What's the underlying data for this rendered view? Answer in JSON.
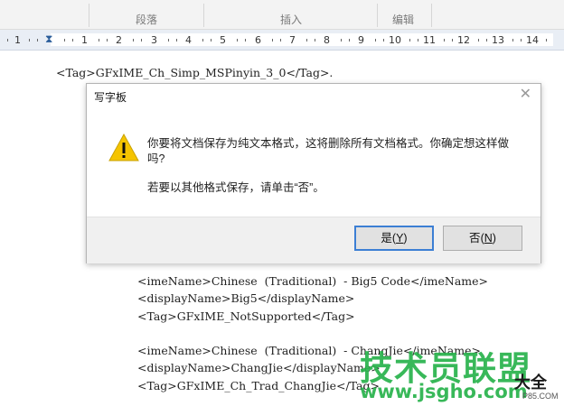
{
  "ribbon": {
    "groups": [
      "段落",
      "插入",
      "编辑"
    ]
  },
  "ruler": {
    "numbers": [
      "1",
      "1",
      "2",
      "3",
      "4",
      "5",
      "6",
      "7",
      "8",
      "9",
      "10",
      "11",
      "12",
      "13",
      "14"
    ]
  },
  "document": {
    "line_top": "<Tag>GFxIME_Ch_Simp_MSPinyin_3_0</Tag>.",
    "lines": [
      "<imeName>Chinese  (Traditional)  - Big5 Code</imeName>",
      "<displayName>Big5</displayName>",
      "<Tag>GFxIME_NotSupported</Tag>",
      "<imeName>Chinese  (Traditional)  - ChangJie</imeName>",
      "<displayName>ChangJie</displayName>",
      "<Tag>GFxIME_Ch_Trad_ChangJie</Tag>"
    ]
  },
  "dialog": {
    "title": "写字板",
    "message_line1": "你要将文档保存为纯文本格式，这将删除所有文档格式。你确定想这样做吗?",
    "message_line2": "若要以其他格式保存，请单击“否”。",
    "yes_label": "是",
    "yes_key": "Y",
    "no_label": "否",
    "no_key": "N",
    "warning_color": "#f5c400"
  },
  "watermark": {
    "line1": "技术员联盟",
    "line2": "www.jsgho.com",
    "brand": "大全",
    "brand_url": "P85.COM"
  }
}
